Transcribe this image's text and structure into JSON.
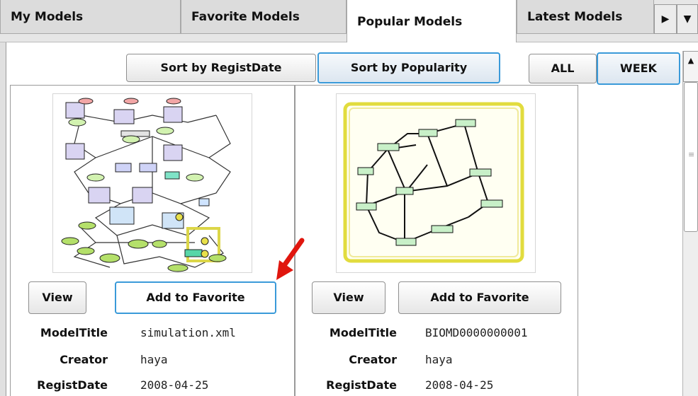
{
  "tabs": [
    {
      "label": "My Models"
    },
    {
      "label": "Favorite Models"
    },
    {
      "label": "Popular Models"
    },
    {
      "label": "Latest Models"
    }
  ],
  "tab_scroll": {
    "right": "▶",
    "menu": "▼"
  },
  "sort_buttons": {
    "regist_date": "Sort by RegistDate",
    "popularity": "Sort by Popularity"
  },
  "period_buttons": {
    "all": "ALL",
    "week": "WEEK"
  },
  "models": [
    {
      "view_label": "View",
      "favorite_label": "Add to Favorite",
      "labels": {
        "title": "ModelTitle",
        "creator": "Creator",
        "date": "RegistDate"
      },
      "values": {
        "title": "simulation.xml",
        "creator": "haya",
        "date": "2008-04-25"
      }
    },
    {
      "view_label": "View",
      "favorite_label": "Add to Favorite",
      "labels": {
        "title": "ModelTitle",
        "creator": "Creator",
        "date": "RegistDate"
      },
      "values": {
        "title": "BIOMD0000000001",
        "creator": "haya",
        "date": "2008-04-25"
      }
    }
  ],
  "colors": {
    "accent_border": "#3a9ad9",
    "annotation_arrow": "#e0160e"
  }
}
